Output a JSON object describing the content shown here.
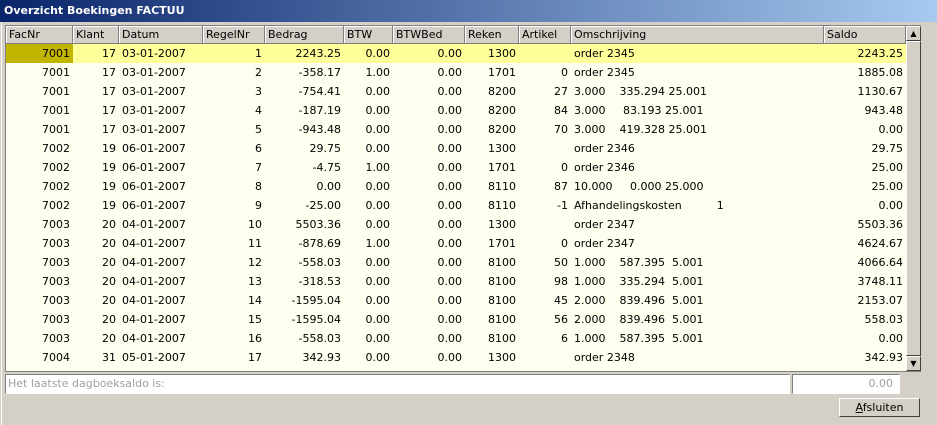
{
  "window": {
    "title": "Overzicht Boekingen FACTUU"
  },
  "grid": {
    "columns": [
      "FacNr",
      "Klant",
      "Datum",
      "RegelNr",
      "Bedrag",
      "BTW",
      "BTWBed",
      "Reken",
      "Artikel",
      "Omschrijving",
      "Saldo"
    ],
    "rows": [
      [
        "7001",
        "17",
        "03-01-2007",
        "1",
        "2243.25",
        "0.00",
        "0.00",
        "1300",
        "",
        "order 2345",
        "2243.25"
      ],
      [
        "7001",
        "17",
        "03-01-2007",
        "2",
        "-358.17",
        "1.00",
        "0.00",
        "1701",
        "0",
        "order 2345",
        "1885.08"
      ],
      [
        "7001",
        "17",
        "03-01-2007",
        "3",
        "-754.41",
        "0.00",
        "0.00",
        "8200",
        "27",
        "3.000    335.294 25.001",
        "1130.67"
      ],
      [
        "7001",
        "17",
        "03-01-2007",
        "4",
        "-187.19",
        "0.00",
        "0.00",
        "8200",
        "84",
        "3.000     83.193 25.001",
        "943.48"
      ],
      [
        "7001",
        "17",
        "03-01-2007",
        "5",
        "-943.48",
        "0.00",
        "0.00",
        "8200",
        "70",
        "3.000    419.328 25.001",
        "0.00"
      ],
      [
        "7002",
        "19",
        "06-01-2007",
        "6",
        "29.75",
        "0.00",
        "0.00",
        "1300",
        "",
        "order 2346",
        "29.75"
      ],
      [
        "7002",
        "19",
        "06-01-2007",
        "7",
        "-4.75",
        "1.00",
        "0.00",
        "1701",
        "0",
        "order 2346",
        "25.00"
      ],
      [
        "7002",
        "19",
        "06-01-2007",
        "8",
        "0.00",
        "0.00",
        "0.00",
        "8110",
        "87",
        "10.000     0.000 25.000",
        "25.00"
      ],
      [
        "7002",
        "19",
        "06-01-2007",
        "9",
        "-25.00",
        "0.00",
        "0.00",
        "8110",
        "-1",
        "Afhandelingskosten          1",
        "0.00"
      ],
      [
        "7003",
        "20",
        "04-01-2007",
        "10",
        "5503.36",
        "0.00",
        "0.00",
        "1300",
        "",
        "order 2347",
        "5503.36"
      ],
      [
        "7003",
        "20",
        "04-01-2007",
        "11",
        "-878.69",
        "1.00",
        "0.00",
        "1701",
        "0",
        "order 2347",
        "4624.67"
      ],
      [
        "7003",
        "20",
        "04-01-2007",
        "12",
        "-558.03",
        "0.00",
        "0.00",
        "8100",
        "50",
        "1.000    587.395  5.001",
        "4066.64"
      ],
      [
        "7003",
        "20",
        "04-01-2007",
        "13",
        "-318.53",
        "0.00",
        "0.00",
        "8100",
        "98",
        "1.000    335.294  5.001",
        "3748.11"
      ],
      [
        "7003",
        "20",
        "04-01-2007",
        "14",
        "-1595.04",
        "0.00",
        "0.00",
        "8100",
        "45",
        "2.000    839.496  5.001",
        "2153.07"
      ],
      [
        "7003",
        "20",
        "04-01-2007",
        "15",
        "-1595.04",
        "0.00",
        "0.00",
        "8100",
        "56",
        "2.000    839.496  5.001",
        "558.03"
      ],
      [
        "7003",
        "20",
        "04-01-2007",
        "16",
        "-558.03",
        "0.00",
        "0.00",
        "8100",
        "6",
        "1.000    587.395  5.001",
        "0.00"
      ],
      [
        "7004",
        "31",
        "05-01-2007",
        "17",
        "342.93",
        "0.00",
        "0.00",
        "1300",
        "",
        "order 2348",
        "342.93"
      ]
    ]
  },
  "footer": {
    "saldo_label": "Het laatste dagboeksaldo is:",
    "saldo_value": "0.00",
    "close_prefix": "",
    "close_underline": "A",
    "close_rest": "fsluiten"
  },
  "colors": {
    "selected_row": "#ffff99",
    "grid_bg": "#fffff0",
    "current_cell": "#c0b400",
    "title_start": "#0a246a",
    "title_end": "#a6caf0"
  }
}
